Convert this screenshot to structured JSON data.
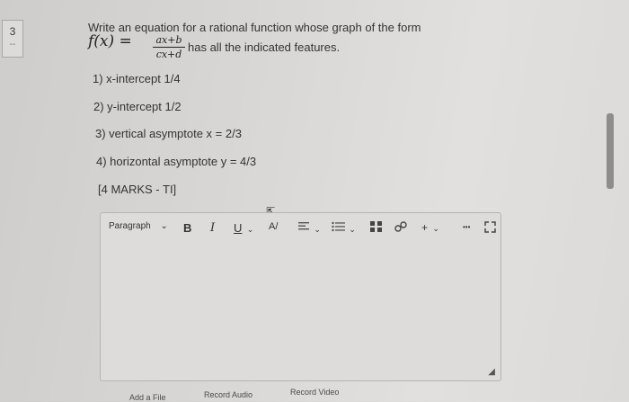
{
  "question": {
    "number": "3",
    "number_sub": "--",
    "prompt": "Write an equation for a rational function whose graph of the form",
    "function_lhs": "f(x) =",
    "numerator": "ax+b",
    "denominator": "cx+d",
    "prompt_cont": "has all the indicated features.",
    "features": [
      "1) x-intercept 1/4",
      "2) y-intercept 1/2",
      "3) vertical asymptote x = 2/3",
      "4) horizontal asymptote y = 4/3"
    ],
    "marks": "[4 MARKS - TI]"
  },
  "editor": {
    "format_label": "Paragraph",
    "format_chevron": "⌄",
    "bold": "B",
    "italic": "I",
    "underline": "U",
    "underline_chevron": "⌄",
    "spell": "A/",
    "align_chevron": "⌄",
    "list_chevron": "⌄",
    "insert": "+",
    "insert_chevron": "⌄",
    "more": "•••"
  },
  "actions": {
    "add_file": "Add a File",
    "record_audio": "Record Audio",
    "record_video": "Record Video"
  }
}
